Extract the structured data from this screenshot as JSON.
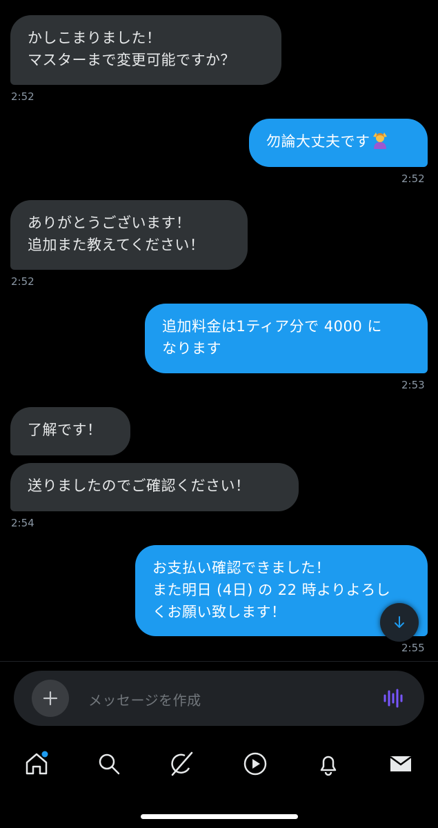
{
  "messages": [
    {
      "dir": "in",
      "text": "かしこまりました！\nマスターまで変更可能ですか？",
      "time": "2:52"
    },
    {
      "dir": "out",
      "text": "勿論大丈夫です",
      "emoji": "person-gesturing-ok-emoji",
      "time": "2:52"
    },
    {
      "dir": "in",
      "text": "ありがとうございます！\n追加また教えてください！",
      "time": "2:52"
    },
    {
      "dir": "out",
      "text": "追加料金は1ティア分で 4000 に\nなります",
      "time": "2:53"
    },
    {
      "dir": "in",
      "text": "了解です！"
    },
    {
      "dir": "in",
      "text": "送りましたのでご確認ください！",
      "time": "2:54"
    },
    {
      "dir": "out",
      "text": "お支払い確認できました！\nまた明日 (4日) の 22 時よりよろし\nくお願い致します！",
      "time": "2:55"
    }
  ],
  "composer": {
    "placeholder": "メッセージを作成"
  },
  "tabbar": {
    "tabs": [
      "home-icon",
      "search-icon",
      "grok-icon",
      "video-icon",
      "notifications-icon",
      "messages-icon"
    ],
    "home_has_dot": true
  },
  "colors": {
    "outgoing": "#1d9bf0",
    "incoming": "#2f3336",
    "background": "#000000",
    "accent_voice": "#7856ff"
  }
}
